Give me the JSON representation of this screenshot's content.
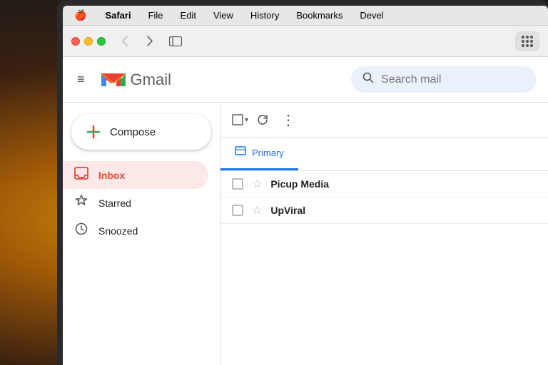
{
  "background": {
    "gradient": "warm amber bokeh background"
  },
  "macos": {
    "menubar": {
      "apple": "🍎",
      "items": [
        "Safari",
        "File",
        "Edit",
        "View",
        "History",
        "Bookmarks",
        "Devel"
      ]
    },
    "toolbar": {
      "back_label": "‹",
      "forward_label": "›",
      "sidebar_icon": "⊡"
    }
  },
  "gmail": {
    "header": {
      "menu_icon": "≡",
      "logo_text": "Gmail",
      "search_placeholder": "Search mail"
    },
    "sidebar": {
      "compose_label": "Compose",
      "nav_items": [
        {
          "id": "inbox",
          "label": "Inbox",
          "active": true
        },
        {
          "id": "starred",
          "label": "Starred",
          "active": false
        },
        {
          "id": "snoozed",
          "label": "Snoozed",
          "active": false
        }
      ]
    },
    "main": {
      "tabs": [
        {
          "id": "primary",
          "label": "Primary",
          "active": true
        }
      ],
      "email_rows": [
        {
          "sender": "Picup Media",
          "preview": "",
          "starred": false
        },
        {
          "sender": "UpViral",
          "preview": "",
          "starred": false
        }
      ]
    }
  }
}
